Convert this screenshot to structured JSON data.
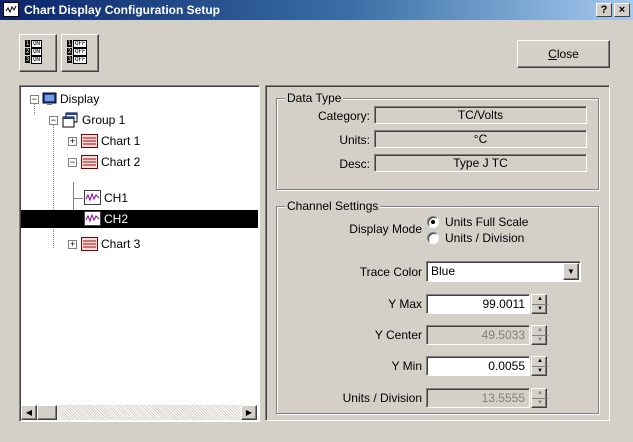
{
  "window": {
    "title": "Chart Display Configuration Setup",
    "help_label": "?",
    "close_label": "×"
  },
  "toolbar": {
    "all_on": {
      "lines": [
        {
          "num": "1",
          "state": "ON"
        },
        {
          "num": "2",
          "state": "ON"
        },
        {
          "num": "3",
          "state": "ON"
        }
      ]
    },
    "all_off": {
      "lines": [
        {
          "num": "1",
          "state": "OFF"
        },
        {
          "num": "2",
          "state": "OFF"
        },
        {
          "num": "3",
          "state": "OFF"
        }
      ]
    },
    "close_button": {
      "label_mnemonic": "C",
      "label_rest": "lose"
    }
  },
  "tree": {
    "root": "Display",
    "group": "Group 1",
    "chart1": "Chart 1",
    "chart2": "Chart 2",
    "ch1": "CH1",
    "ch2": "CH2",
    "chart3": "Chart 3",
    "selected": "CH2"
  },
  "data_type": {
    "title": "Data Type",
    "category_label": "Category:",
    "category_value": "TC/Volts",
    "units_label": "Units:",
    "units_value": "°C",
    "desc_label": "Desc:",
    "desc_value": "Type J TC"
  },
  "channel_settings": {
    "title": "Channel Settings",
    "display_mode_label": "Display Mode",
    "mode_full_scale": "Units Full Scale",
    "mode_per_division": "Units / Division",
    "selected_mode": "Units Full Scale",
    "trace_color_label": "Trace Color",
    "trace_color_value": "Blue",
    "y_max_label": "Y Max",
    "y_max_value": "99.0011",
    "y_center_label": "Y Center",
    "y_center_value": "49.5033",
    "y_min_label": "Y Min",
    "y_min_value": "0.0055",
    "units_div_label": "Units / Division",
    "units_div_value": "13.5555"
  }
}
